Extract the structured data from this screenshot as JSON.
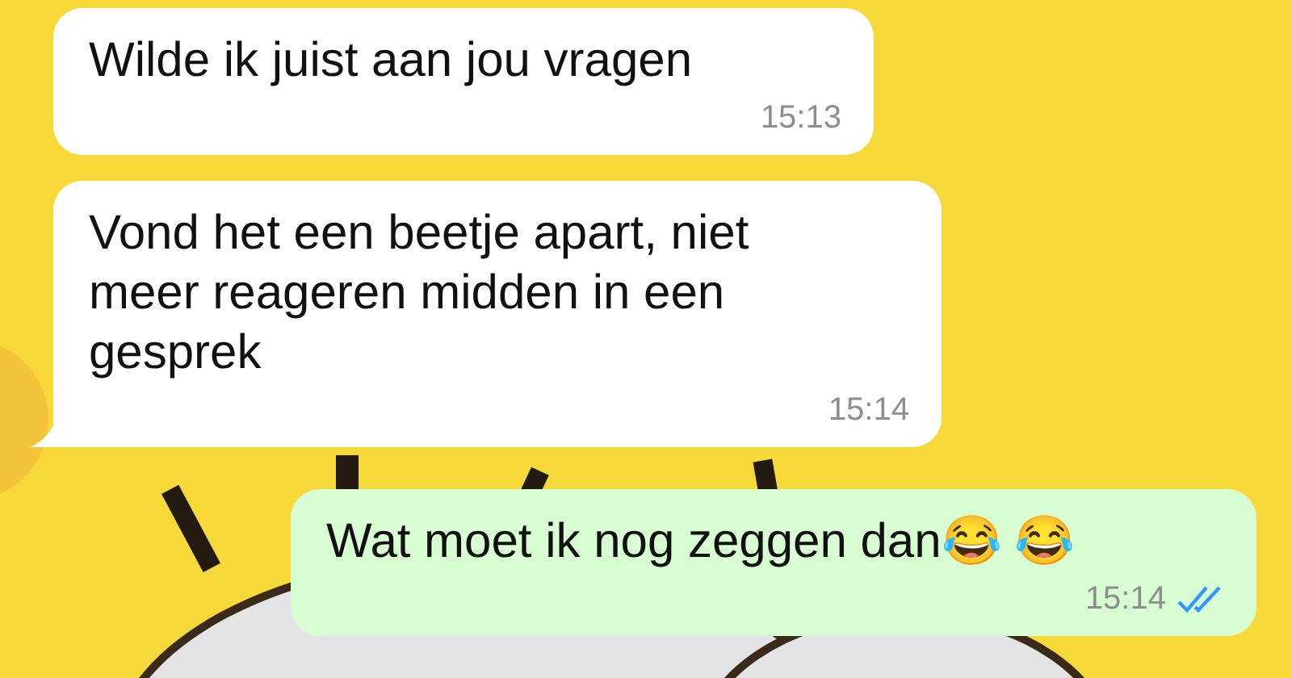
{
  "messages": [
    {
      "sent": false,
      "text": "Wilde ik juist aan jou vragen",
      "time": "15:13",
      "tail": false
    },
    {
      "sent": false,
      "text": "Vond het een beetje apart, niet meer reageren midden in een gesprek",
      "time": "15:14",
      "tail": true
    },
    {
      "sent": true,
      "text": "Wat moet ik nog zeggen dan😂 😂",
      "time": "15:14",
      "tail": false,
      "read": true
    }
  ]
}
